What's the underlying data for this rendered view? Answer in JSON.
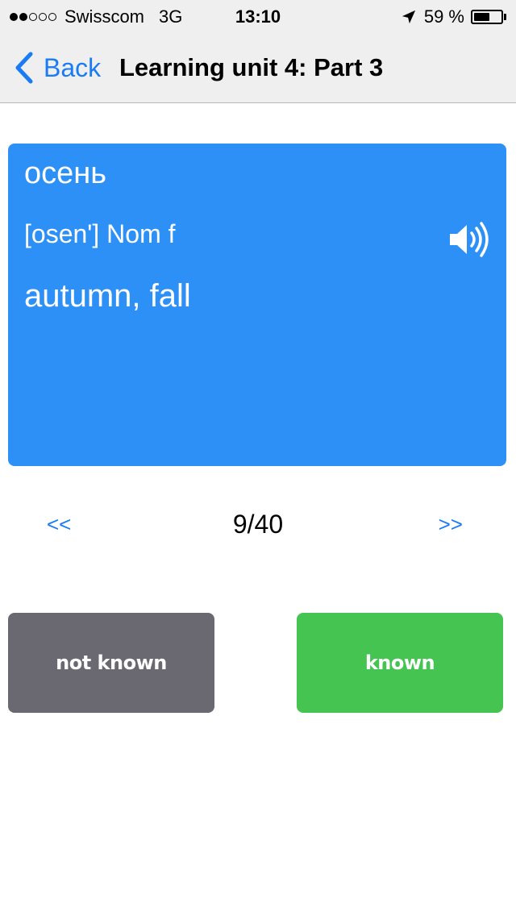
{
  "status_bar": {
    "signal_dots_filled": 2,
    "signal_dots_total": 5,
    "carrier": "Swisscom",
    "network": "3G",
    "time": "13:10",
    "battery_percent_label": "59 %",
    "battery_level": 0.59,
    "icons": [
      "signal-dots-icon",
      "location-arrow-icon",
      "battery-icon"
    ]
  },
  "nav": {
    "back_label": "Back",
    "title": "Learning unit 4: Part 3",
    "back_icon": "chevron-left-icon",
    "accent_color": "#1a7cf5"
  },
  "card": {
    "word": "осень",
    "pronunciation": "[osen'] Nom f",
    "translation": "autumn, fall",
    "speaker_icon": "speaker-icon",
    "background_color": "#2d90f6"
  },
  "pager": {
    "prev_label": "<<",
    "count": "9/40",
    "next_label": ">>"
  },
  "answers": {
    "not_known_label": "not known",
    "known_label": "known",
    "not_known_color": "#6a6870",
    "known_color": "#45c452"
  }
}
